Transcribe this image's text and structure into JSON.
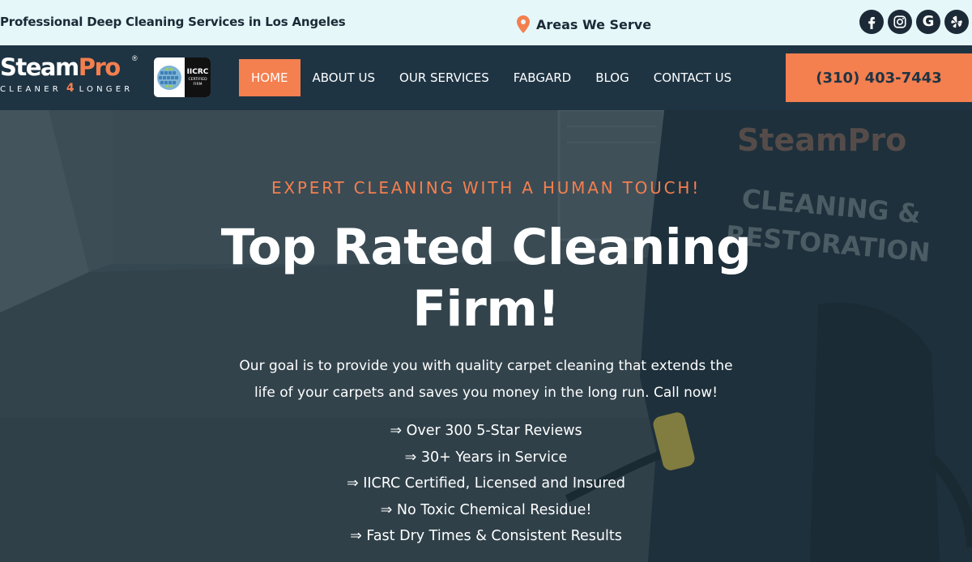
{
  "topbar": {
    "tagline": "Professional Deep Cleaning Services in Los Angeles",
    "areas_label": "Areas We Serve",
    "socials": [
      {
        "icon": "facebook-icon"
      },
      {
        "icon": "instagram-icon"
      },
      {
        "icon": "google-icon",
        "glyph": "G"
      },
      {
        "icon": "yelp-icon"
      }
    ]
  },
  "header": {
    "logo": {
      "word_main": "Steam",
      "word_accent": "Pro",
      "registered": "®",
      "sub_left": "CLEANER",
      "sub_mid": "4",
      "sub_right": "LONGER"
    },
    "badge": {
      "title": "IICRC",
      "subtitle_line1": "CERTIFIED",
      "subtitle_line2": "FIRM"
    },
    "nav": [
      {
        "label": "HOME",
        "active": true
      },
      {
        "label": "ABOUT US"
      },
      {
        "label": "OUR SERVICES"
      },
      {
        "label": "FABGARD"
      },
      {
        "label": "BLOG"
      },
      {
        "label": "CONTACT US"
      }
    ],
    "phone": "(310) 403-7443"
  },
  "hero": {
    "eyebrow": "EXPERT CLEANING WITH A HUMAN TOUCH!",
    "headline_line1": "Top Rated Cleaning",
    "headline_line2": "Firm!",
    "lead_line1": "Our goal is to provide you with quality carpet cleaning that extends the",
    "lead_line2": "life of your carpets and saves you money in the long run. Call now!",
    "bullets": [
      "⇒ Over 300 5-Star Reviews",
      "⇒ 30+ Years in Service",
      "⇒ IICRC Certified, Licensed and Insured",
      "⇒ No Toxic Chemical Residue!",
      "⇒ Fast Dry Times & Consistent Results"
    ],
    "photo_shirt_brand": "SteamPro",
    "photo_shirt_line1": "CLEANING &",
    "photo_shirt_line2": "RESTORATION"
  },
  "colors": {
    "accent": "#f47f4f",
    "navy": "#1e3443",
    "topbar_bg": "#e6f7fa"
  }
}
